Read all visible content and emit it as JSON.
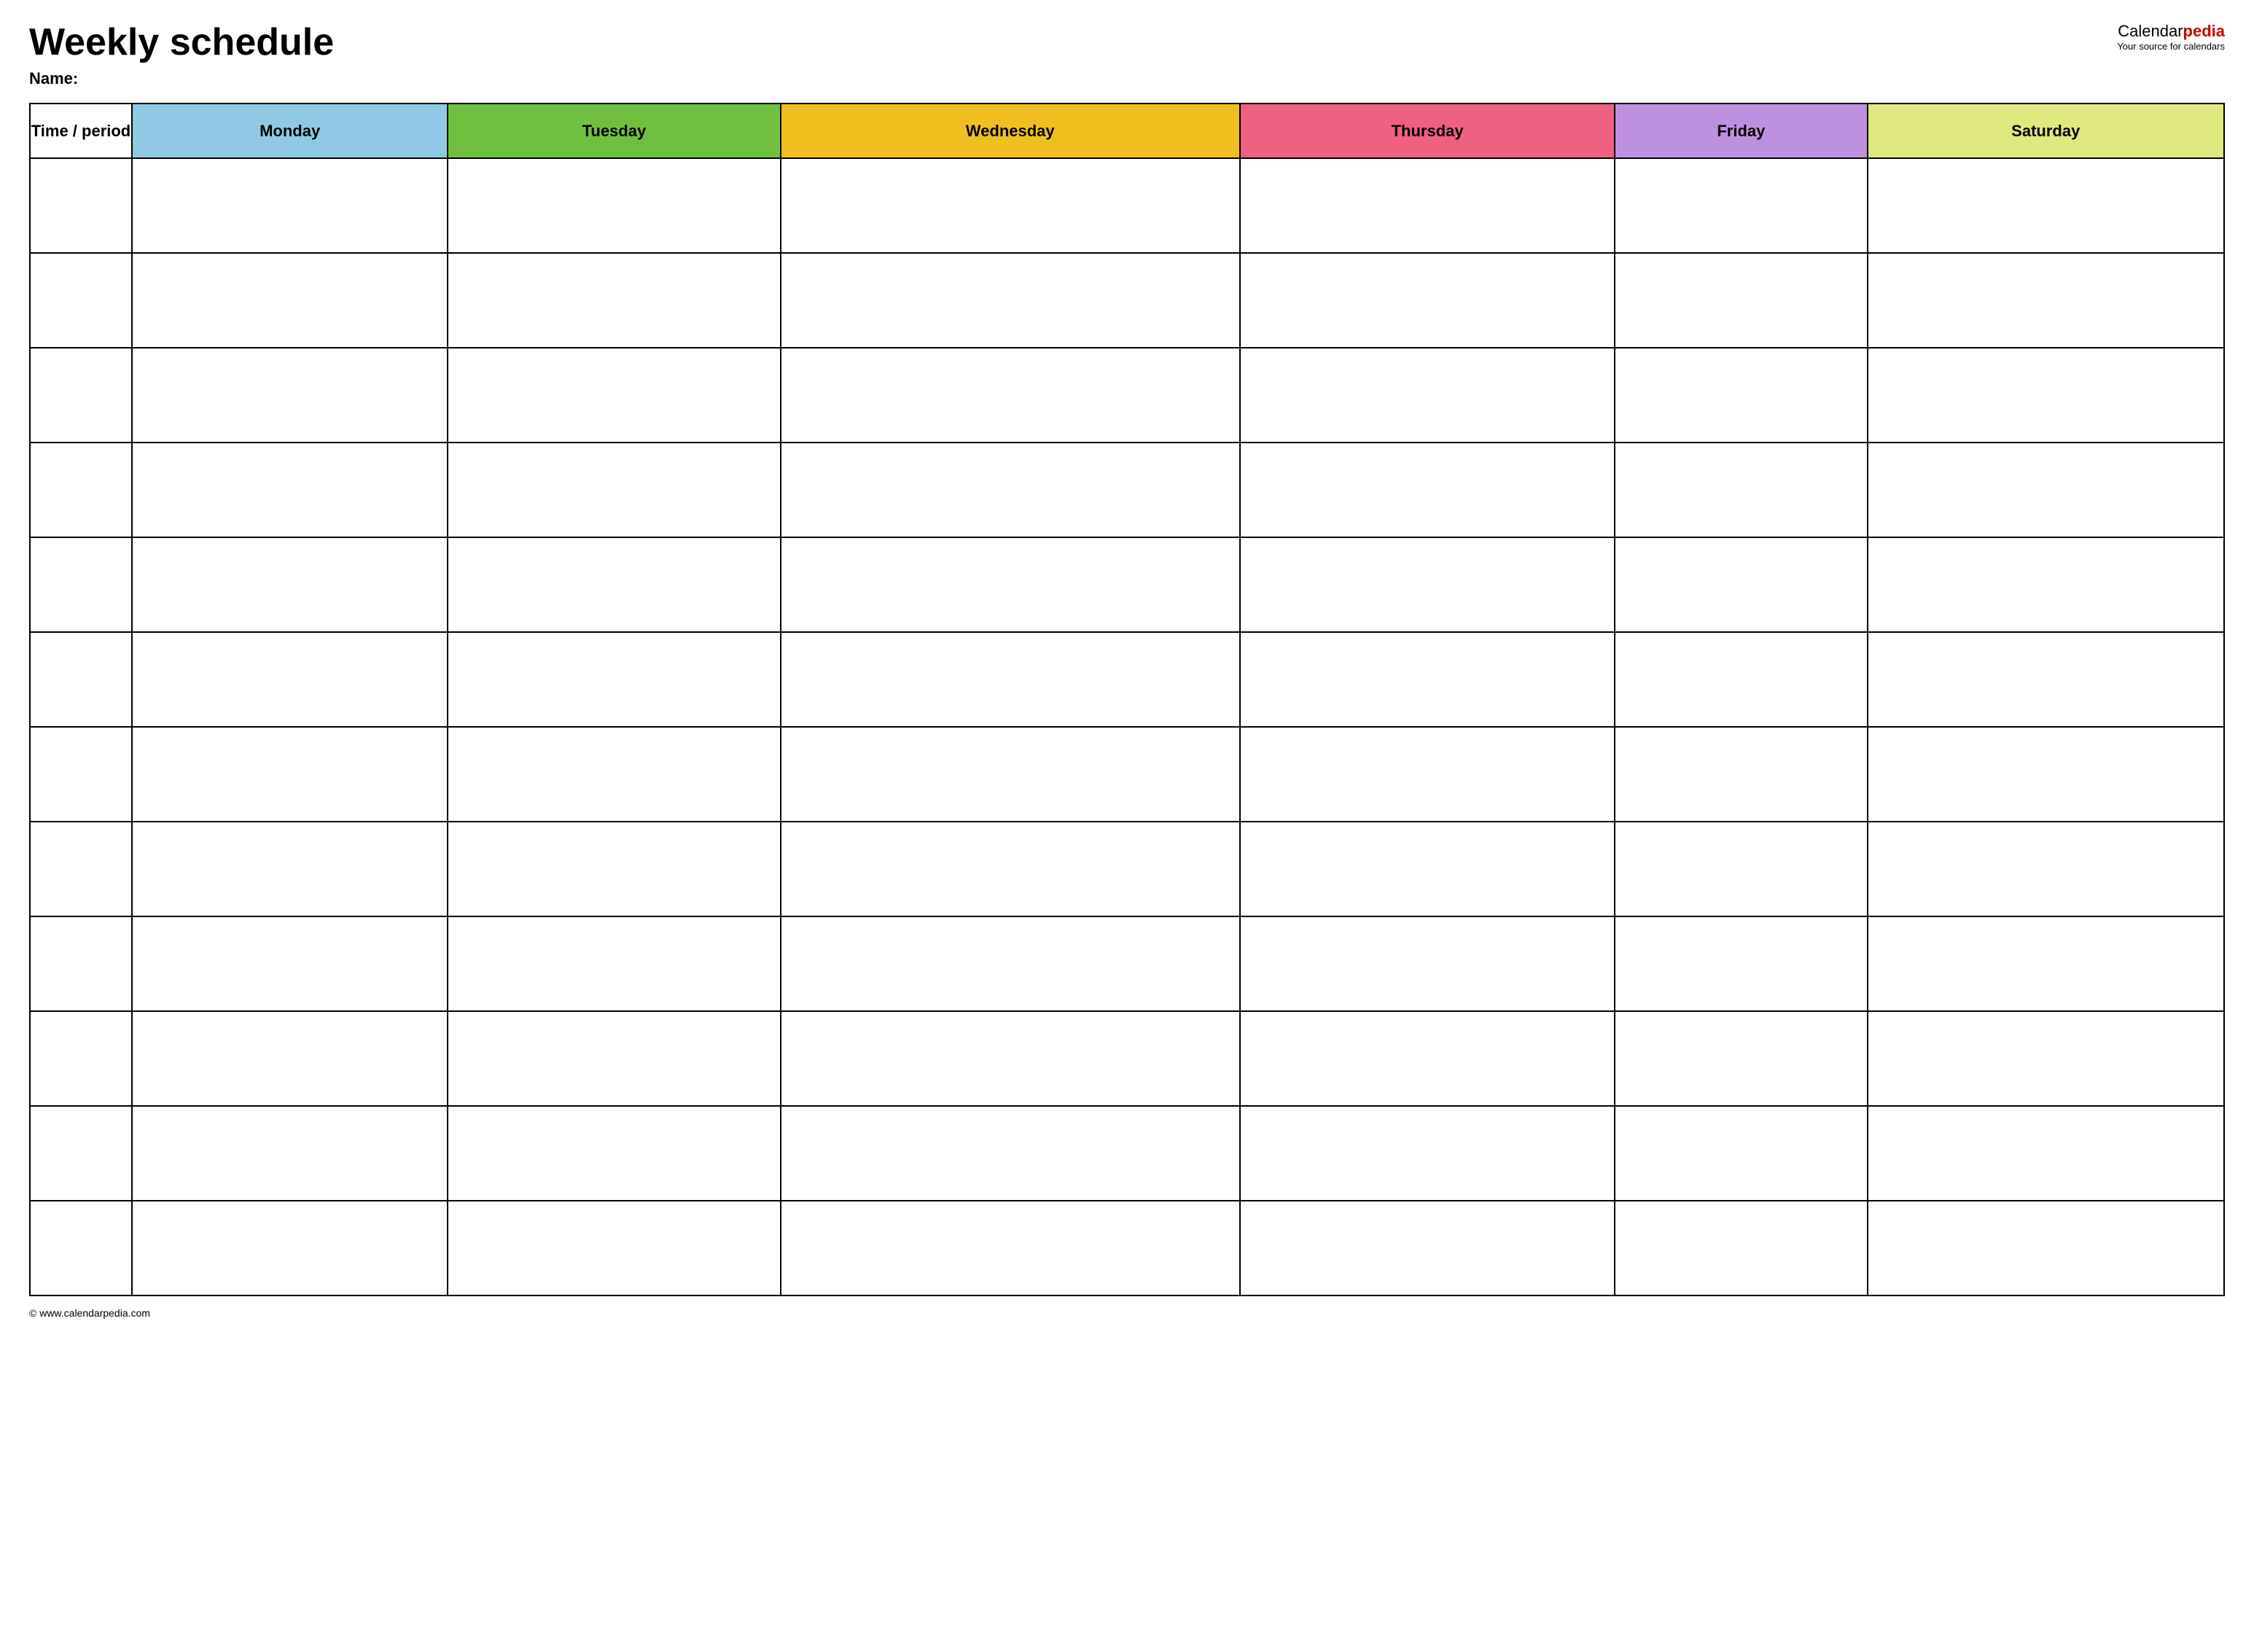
{
  "header": {
    "title": "Weekly schedule",
    "name_label": "Name:",
    "logo_text_calendar": "Calendar",
    "logo_text_pedia": "pedia",
    "logo_subtitle": "Your source for calendars"
  },
  "table": {
    "headers": [
      {
        "id": "time",
        "label": "Time / period",
        "color": "#ffffff",
        "class": "time-header"
      },
      {
        "id": "monday",
        "label": "Monday",
        "color": "#8ecae6",
        "class": "monday"
      },
      {
        "id": "tuesday",
        "label": "Tuesday",
        "color": "#70c040",
        "class": "tuesday"
      },
      {
        "id": "wednesday",
        "label": "Wednesday",
        "color": "#f0c020",
        "class": "wednesday"
      },
      {
        "id": "thursday",
        "label": "Thursday",
        "color": "#f06080",
        "class": "thursday"
      },
      {
        "id": "friday",
        "label": "Friday",
        "color": "#c090e0",
        "class": "friday"
      },
      {
        "id": "saturday",
        "label": "Saturday",
        "color": "#e0e880",
        "class": "saturday"
      }
    ],
    "row_count": 12
  },
  "footer": {
    "url": "© www.calendarpedia.com"
  }
}
